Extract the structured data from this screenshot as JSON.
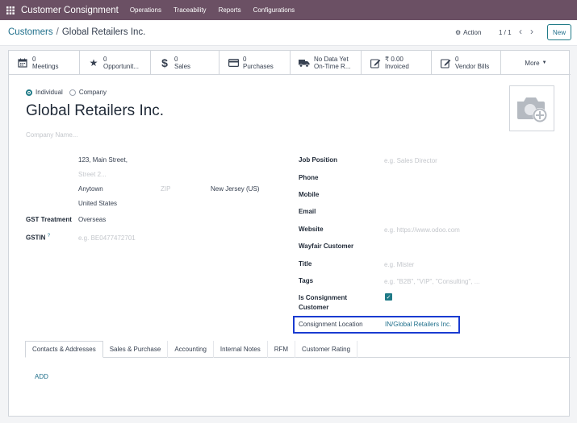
{
  "topbar": {
    "app_title": "Customer Consignment",
    "menu": [
      "Operations",
      "Traceability",
      "Reports",
      "Configurations"
    ]
  },
  "control": {
    "breadcrumb_parent": "Customers",
    "breadcrumb_sep": "/",
    "breadcrumb_current": "Global Retailers Inc.",
    "action_label": "Action",
    "pager": "1 / 1",
    "new_label": "New"
  },
  "stats": [
    {
      "icon": "calendar-icon",
      "value": "0",
      "label": "Meetings"
    },
    {
      "icon": "star-icon",
      "value": "0",
      "label": "Opportunit..."
    },
    {
      "icon": "dollar-icon",
      "value": "0",
      "label": "Sales"
    },
    {
      "icon": "credit-card-icon",
      "value": "0",
      "label": "Purchases"
    },
    {
      "icon": "truck-icon",
      "value": "No Data Yet",
      "label": "On-Time R..."
    },
    {
      "icon": "edit-icon",
      "value": "₹ 0.00",
      "label": "Invoiced"
    },
    {
      "icon": "edit-icon",
      "value": "0",
      "label": "Vendor Bills"
    }
  ],
  "more_label": "More",
  "form": {
    "radio_individual": "Individual",
    "radio_company": "Company",
    "name": "Global Retailers Inc.",
    "company_name_placeholder": "Company Name...",
    "street": "123, Main Street,",
    "street2_placeholder": "Street 2...",
    "city": "Anytown",
    "zip_placeholder": "ZIP",
    "state": "New Jersey (US)",
    "country": "United States",
    "gst_treatment_label": "GST Treatment",
    "gst_treatment_value": "Overseas",
    "gstin_label": "GSTIN",
    "gstin_help": "?",
    "gstin_placeholder": "e.g. BE0477472701",
    "job_position_label": "Job Position",
    "job_position_placeholder": "e.g. Sales Director",
    "phone_label": "Phone",
    "mobile_label": "Mobile",
    "email_label": "Email",
    "website_label": "Website",
    "website_placeholder": "e.g. https://www.odoo.com",
    "wayfair_label": "Wayfair Customer",
    "title_label": "Title",
    "title_placeholder": "e.g. Mister",
    "tags_label": "Tags",
    "tags_placeholder": "e.g. \"B2B\", \"VIP\", \"Consulting\", ...",
    "is_consignment_label_1": "Is Consignment",
    "is_consignment_label_2": "Customer",
    "is_consignment_checked": true,
    "consignment_location_label": "Consignment Location",
    "consignment_location_value": "IN/Global Retailers Inc."
  },
  "tabs": [
    "Contacts & Addresses",
    "Sales & Purchase",
    "Accounting",
    "Internal Notes",
    "RFM",
    "Customer Rating"
  ],
  "add_label": "ADD",
  "colors": {
    "topbar": "#6b5064",
    "accent": "#1f7a87",
    "highlight_border": "#1a3bd1"
  }
}
